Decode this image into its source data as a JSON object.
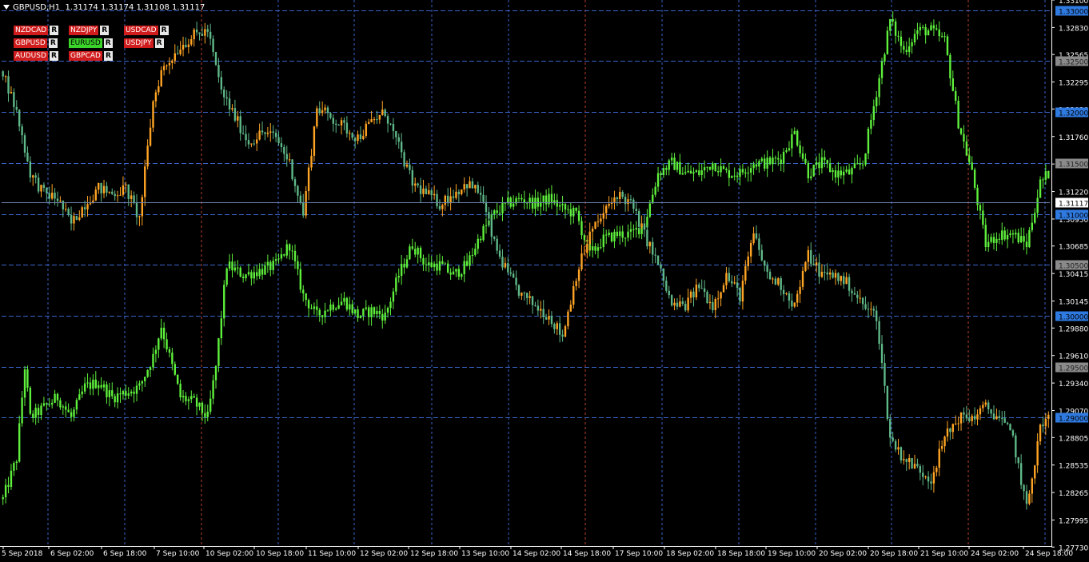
{
  "header": {
    "symbol": "GBPUSD,H1",
    "ohlc": "1.31174 1.31174 1.31108 1.31117"
  },
  "colors": {
    "background": "#000000",
    "grid_v_blue": "#3a64c8",
    "grid_v_red": "#b8402e",
    "level_line": "#3a64c8",
    "axis_text": "#ffffff",
    "bull_primary": "#ffa424",
    "bear_primary": "#5fb888",
    "secondary": "#5ef03c",
    "price_line": "#6a7ea8",
    "label_blue_bg": "#2f7ae0",
    "label_gray_bg": "#8a8a8a",
    "label_current_bg": "#ffffff",
    "btn_red": "#d01c1c",
    "btn_green": "#3bd42a"
  },
  "pair_buttons": [
    {
      "symbol": "NZDCAD",
      "r": "R",
      "color": "red"
    },
    {
      "symbol": "NZDJPY",
      "r": "R",
      "color": "red"
    },
    {
      "symbol": "USDCAD",
      "r": "R",
      "color": "red"
    },
    {
      "symbol": "GBPUSD",
      "r": "R",
      "color": "red"
    },
    {
      "symbol": "EURUSD",
      "r": "R",
      "color": "green"
    },
    {
      "symbol": "USDJPY",
      "r": "R",
      "color": "red"
    },
    {
      "symbol": "AUDUSD",
      "r": "R",
      "color": "red"
    },
    {
      "symbol": "GBPCAD",
      "r": "R",
      "color": "red"
    }
  ],
  "chart_data": {
    "type": "candlestick",
    "price_axis": {
      "min": 1.2774,
      "max": 1.331,
      "ticks": [
        "1.33100",
        "1.32830",
        "1.32565",
        "1.32295",
        "1.32030",
        "1.31760",
        "1.31490",
        "1.31220",
        "1.30950",
        "1.30685",
        "1.30415",
        "1.30145",
        "1.29880",
        "1.29610",
        "1.29340",
        "1.29070",
        "1.28805",
        "1.28535",
        "1.28265",
        "1.27995",
        "1.27730"
      ]
    },
    "levels": [
      {
        "price": 1.33,
        "label": "1.33000",
        "style": "blue"
      },
      {
        "price": 1.325,
        "label": "1.32500",
        "style": "gray"
      },
      {
        "price": 1.32,
        "label": "1.32000",
        "style": "blue"
      },
      {
        "price": 1.315,
        "label": "1.31500",
        "style": "gray"
      },
      {
        "price": 1.31,
        "label": "1.31000",
        "style": "blue"
      },
      {
        "price": 1.305,
        "label": "1.30500",
        "style": "gray"
      },
      {
        "price": 1.3,
        "label": "1.30000",
        "style": "blue"
      },
      {
        "price": 1.295,
        "label": "1.29500",
        "style": "gray"
      },
      {
        "price": 1.29,
        "label": "1.29000",
        "style": "blue"
      }
    ],
    "current_price": {
      "price": 1.31117,
      "label": "1.31117"
    },
    "time_labels": [
      "5 Sep 2018",
      "6 Sep 02:00",
      "6 Sep 18:00",
      "7 Sep 10:00",
      "10 Sep 02:00",
      "10 Sep 18:00",
      "11 Sep 10:00",
      "12 Sep 02:00",
      "12 Sep 18:00",
      "13 Sep 10:00",
      "14 Sep 02:00",
      "14 Sep 18:00",
      "17 Sep 10:00",
      "18 Sep 02:00",
      "18 Sep 18:00",
      "19 Sep 10:00",
      "20 Sep 02:00",
      "20 Sep 18:00",
      "21 Sep 10:00",
      "24 Sep 02:00",
      "24 Sep 18:00"
    ],
    "session_separators": [
      "7 Sep 10:00",
      "14 Sep 02:00",
      "21 Sep 10:00"
    ],
    "bars": 320,
    "series": [
      {
        "name": "GBPUSD",
        "style": "candles",
        "anchors": [
          [
            0,
            1.324
          ],
          [
            5,
            1.32
          ],
          [
            10,
            1.314
          ],
          [
            15,
            1.312
          ],
          [
            20,
            1.3115
          ],
          [
            25,
            1.309
          ],
          [
            30,
            1.311
          ],
          [
            35,
            1.3125
          ],
          [
            40,
            1.312
          ],
          [
            45,
            1.3125
          ],
          [
            50,
            1.3095
          ],
          [
            55,
            1.321
          ],
          [
            58,
            1.324
          ],
          [
            65,
            1.3265
          ],
          [
            70,
            1.3275
          ],
          [
            75,
            1.328
          ],
          [
            80,
            1.322
          ],
          [
            85,
            1.3195
          ],
          [
            90,
            1.317
          ],
          [
            95,
            1.318
          ],
          [
            100,
            1.3175
          ],
          [
            105,
            1.315
          ],
          [
            110,
            1.31
          ],
          [
            115,
            1.3205
          ],
          [
            120,
            1.3195
          ],
          [
            125,
            1.3185
          ],
          [
            130,
            1.3175
          ],
          [
            135,
            1.319
          ],
          [
            140,
            1.32
          ],
          [
            145,
            1.3165
          ],
          [
            150,
            1.313
          ],
          [
            155,
            1.312
          ],
          [
            160,
            1.311
          ],
          [
            165,
            1.312
          ],
          [
            170,
            1.313
          ],
          [
            175,
            1.312
          ],
          [
            180,
            1.307
          ],
          [
            185,
            1.304
          ],
          [
            190,
            1.302
          ],
          [
            195,
            1.301
          ],
          [
            200,
            1.3
          ],
          [
            205,
            1.298
          ],
          [
            210,
            1.304
          ],
          [
            215,
            1.308
          ],
          [
            220,
            1.31
          ],
          [
            225,
            1.312
          ],
          [
            230,
            1.311
          ],
          [
            235,
            1.308
          ],
          [
            240,
            1.305
          ],
          [
            245,
            1.301
          ],
          [
            250,
            1.301
          ],
          [
            255,
            1.303
          ],
          [
            260,
            1.301
          ],
          [
            265,
            1.304
          ],
          [
            270,
            1.302
          ],
          [
            275,
            1.308
          ],
          [
            280,
            1.304
          ],
          [
            285,
            1.303
          ],
          [
            290,
            1.301
          ],
          [
            295,
            1.306
          ],
          [
            300,
            1.304
          ],
          [
            305,
            1.304
          ],
          [
            310,
            1.303
          ],
          [
            315,
            1.301
          ],
          [
            320,
            1.3
          ],
          [
            325,
            1.288
          ],
          [
            330,
            1.286
          ],
          [
            335,
            1.285
          ],
          [
            340,
            1.284
          ],
          [
            345,
            1.288
          ],
          [
            350,
            1.29
          ],
          [
            355,
            1.29
          ],
          [
            360,
            1.291
          ],
          [
            365,
            1.29
          ],
          [
            370,
            1.288
          ],
          [
            375,
            1.281
          ],
          [
            380,
            1.289
          ],
          [
            383,
            1.29
          ]
        ]
      },
      {
        "name": "EURUSD",
        "style": "line-candles",
        "anchors": [
          [
            0,
            1.282
          ],
          [
            5,
            1.286
          ],
          [
            8,
            1.295
          ],
          [
            10,
            1.29
          ],
          [
            15,
            1.291
          ],
          [
            20,
            1.292
          ],
          [
            25,
            1.29
          ],
          [
            30,
            1.293
          ],
          [
            35,
            1.2935
          ],
          [
            40,
            1.292
          ],
          [
            45,
            1.2925
          ],
          [
            50,
            1.293
          ],
          [
            55,
            1.296
          ],
          [
            58,
            1.299
          ],
          [
            65,
            1.292
          ],
          [
            70,
            1.2915
          ],
          [
            75,
            1.29
          ],
          [
            78,
            1.295
          ],
          [
            82,
            1.305
          ],
          [
            88,
            1.304
          ],
          [
            95,
            1.3045
          ],
          [
            100,
            1.305
          ],
          [
            105,
            1.307
          ],
          [
            110,
            1.302
          ],
          [
            115,
            1.3
          ],
          [
            120,
            1.301
          ],
          [
            125,
            1.3015
          ],
          [
            130,
            1.3
          ],
          [
            135,
            1.3005
          ],
          [
            140,
            1.3
          ],
          [
            145,
            1.304
          ],
          [
            150,
            1.307
          ],
          [
            155,
            1.305
          ],
          [
            160,
            1.305
          ],
          [
            165,
            1.304
          ],
          [
            170,
            1.305
          ],
          [
            175,
            1.308
          ],
          [
            180,
            1.31
          ],
          [
            185,
            1.311
          ],
          [
            190,
            1.3115
          ],
          [
            195,
            1.311
          ],
          [
            200,
            1.3115
          ],
          [
            205,
            1.3105
          ],
          [
            210,
            1.31
          ],
          [
            215,
            1.306
          ],
          [
            220,
            1.3075
          ],
          [
            225,
            1.308
          ],
          [
            230,
            1.308
          ],
          [
            235,
            1.309
          ],
          [
            240,
            1.314
          ],
          [
            245,
            1.315
          ],
          [
            250,
            1.314
          ],
          [
            255,
            1.314
          ],
          [
            260,
            1.315
          ],
          [
            265,
            1.314
          ],
          [
            270,
            1.314
          ],
          [
            275,
            1.315
          ],
          [
            280,
            1.315
          ],
          [
            285,
            1.3155
          ],
          [
            290,
            1.318
          ],
          [
            295,
            1.314
          ],
          [
            300,
            1.315
          ],
          [
            305,
            1.314
          ],
          [
            310,
            1.314
          ],
          [
            315,
            1.315
          ],
          [
            320,
            1.322
          ],
          [
            325,
            1.329
          ],
          [
            330,
            1.326
          ],
          [
            335,
            1.328
          ],
          [
            340,
            1.328
          ],
          [
            345,
            1.327
          ],
          [
            350,
            1.319
          ],
          [
            355,
            1.314
          ],
          [
            360,
            1.307
          ],
          [
            365,
            1.308
          ],
          [
            370,
            1.308
          ],
          [
            375,
            1.307
          ],
          [
            380,
            1.313
          ],
          [
            383,
            1.314
          ]
        ]
      }
    ]
  }
}
